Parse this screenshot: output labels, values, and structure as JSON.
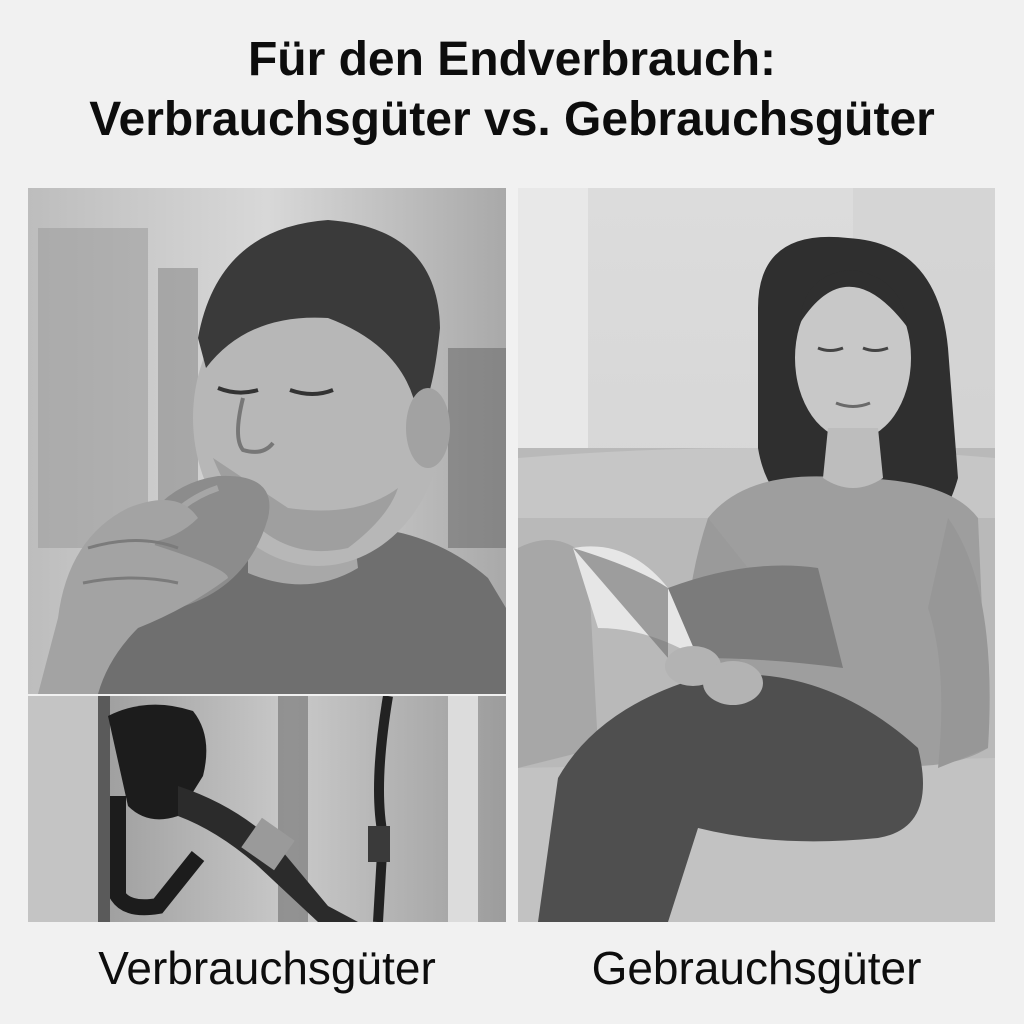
{
  "title": {
    "line1": "Für den Endverbrauch:",
    "line2": "Verbrauchsgüter vs. Gebrauchsgüter"
  },
  "captions": {
    "left": "Verbrauchsgüter",
    "right": "Gebrauchsgüter"
  },
  "photos": {
    "style": "black-and-white",
    "eating": "man-eating-bread",
    "fuel": "fuel-pump-nozzle",
    "reading": "woman-reading-book-on-sofa"
  }
}
